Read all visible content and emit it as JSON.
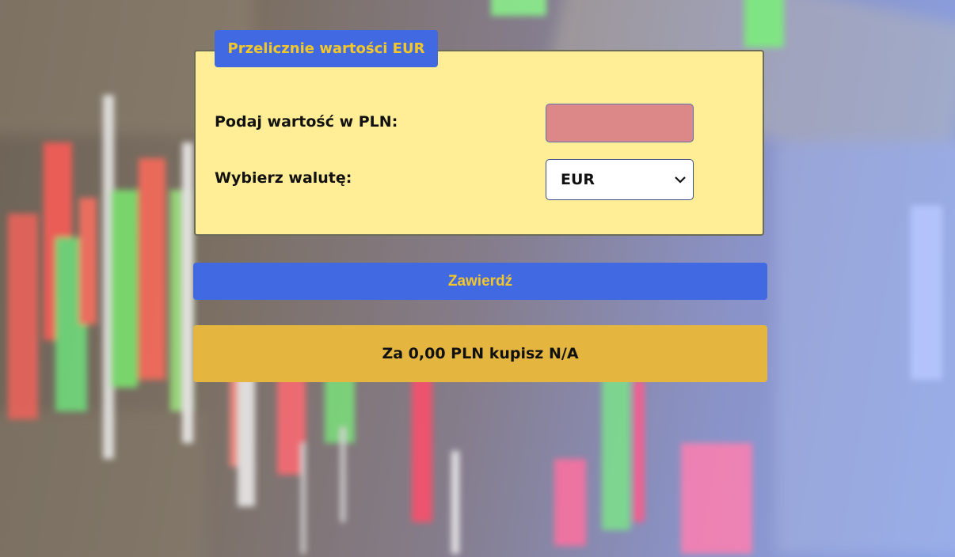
{
  "form": {
    "legend": "Przelicznie wartości EUR",
    "amount_label": "Podaj wartość w PLN:",
    "amount_value": "",
    "currency_label": "Wybierz walutę:",
    "currency_selected": "EUR",
    "currency_icon": "chevron-down-icon"
  },
  "submit_button": {
    "label": "Zawierdź"
  },
  "result": {
    "text": "Za 0,00 PLN kupisz N/A"
  },
  "colors": {
    "form_background": "#ffee96",
    "accent_blue": "#4169e1",
    "accent_yellow": "#f3c72a",
    "input_fill": "#dc8888",
    "result_background": "#e4b640"
  }
}
